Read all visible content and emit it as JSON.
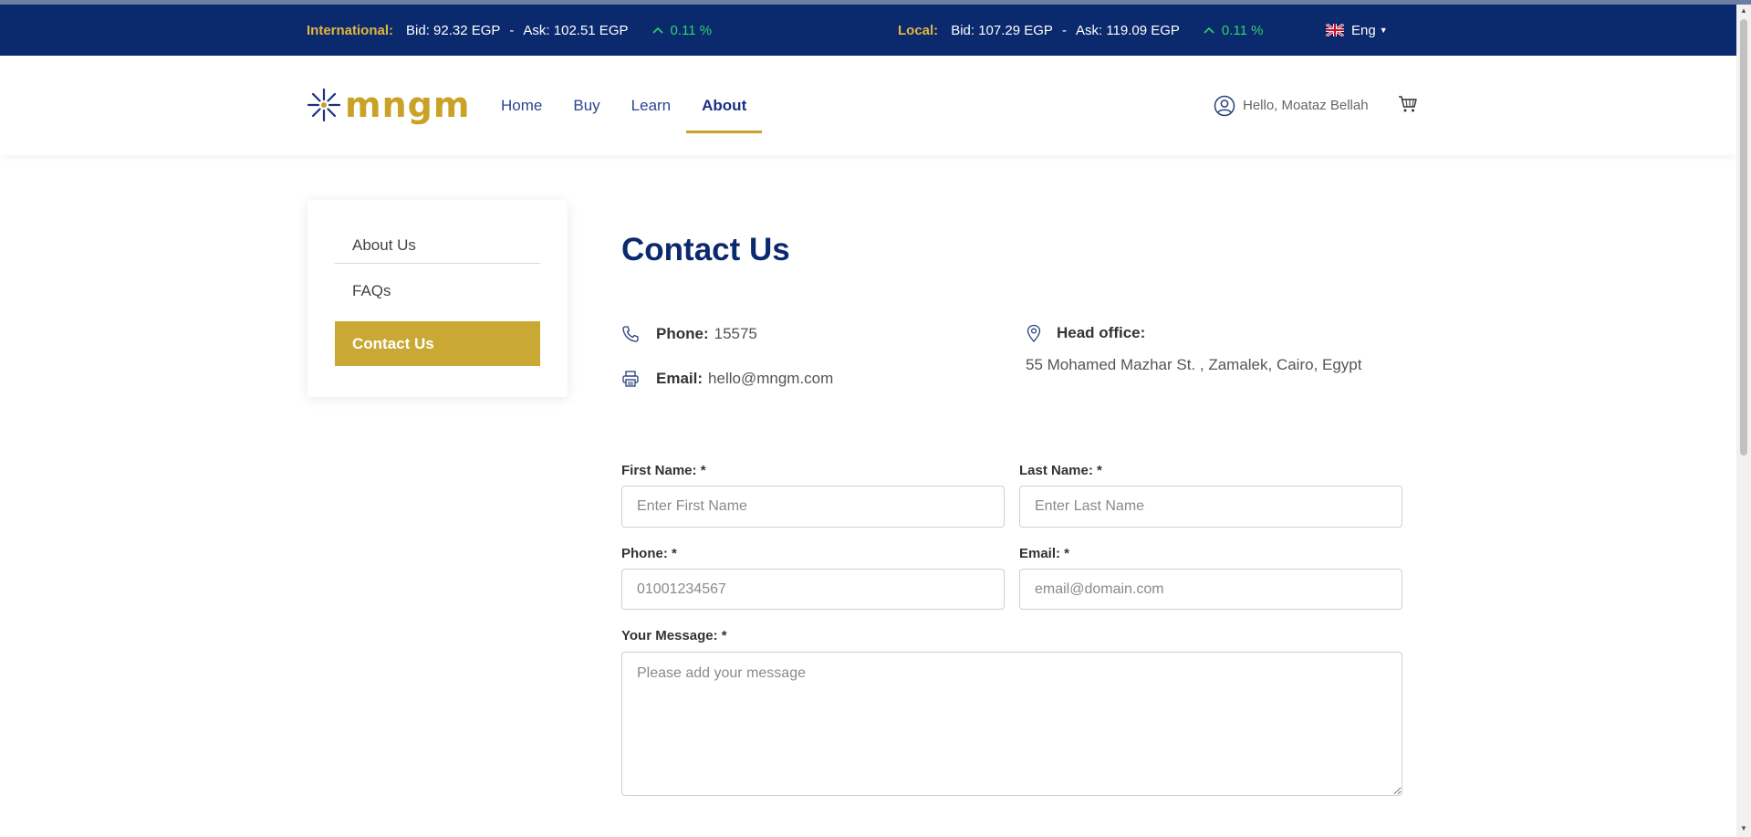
{
  "ticker": {
    "international": {
      "label": "International:",
      "bid": "Bid: 92.32 EGP",
      "separator": "-",
      "ask": "Ask: 102.51 EGP",
      "change": "0.11 %"
    },
    "local": {
      "label": "Local:",
      "bid": "Bid: 107.29 EGP",
      "separator": "-",
      "ask": "Ask: 119.09 EGP",
      "change": "0.11 %"
    },
    "language": "Eng"
  },
  "header": {
    "logo_text": "mngm",
    "nav": [
      {
        "label": "Home"
      },
      {
        "label": "Buy"
      },
      {
        "label": "Learn"
      },
      {
        "label": "About"
      }
    ],
    "active_nav": "About",
    "greeting": "Hello, Moataz Bellah"
  },
  "sidebar": {
    "items": [
      {
        "label": "About Us"
      },
      {
        "label": "FAQs"
      },
      {
        "label": "Contact Us"
      }
    ],
    "active": "Contact Us"
  },
  "main": {
    "title": "Contact Us",
    "phone": {
      "label": "Phone:",
      "value": "15575"
    },
    "email": {
      "label": "Email:",
      "value": "hello@mngm.com"
    },
    "office": {
      "label": "Head office:",
      "address": "55 Mohamed Mazhar St. , Zamalek, Cairo, Egypt"
    }
  },
  "form": {
    "first_name": {
      "label": "First Name: *",
      "placeholder": "Enter First Name",
      "value": ""
    },
    "last_name": {
      "label": "Last Name: *",
      "placeholder": "Enter Last Name",
      "value": ""
    },
    "phone": {
      "label": "Phone: *",
      "placeholder": "01001234567",
      "value": ""
    },
    "email": {
      "label": "Email: *",
      "placeholder": "email@domain.com",
      "value": ""
    },
    "message": {
      "label": "Your Message: *",
      "placeholder": "Please add your message",
      "value": ""
    }
  },
  "colors": {
    "navy": "#0b2a6e",
    "gold": "#c9a933",
    "positive": "#2fd36b"
  }
}
